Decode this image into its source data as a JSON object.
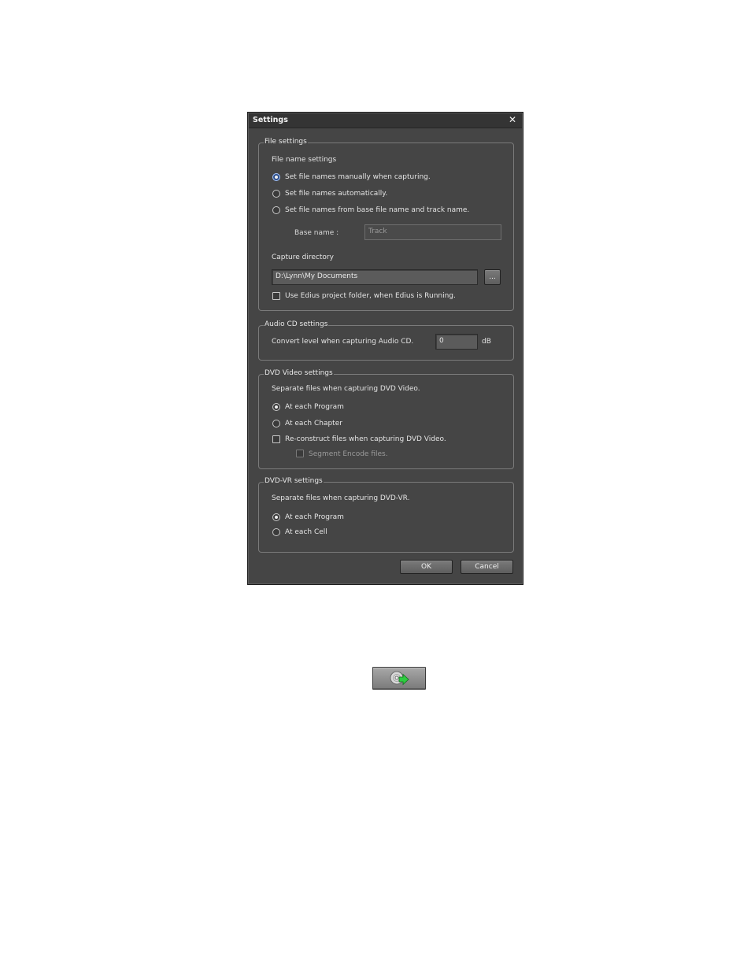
{
  "dialog": {
    "title": "Settings",
    "close_icon": "close-icon",
    "close_glyph": "✕"
  },
  "file_settings": {
    "legend": "File settings",
    "file_name_heading": "File name settings",
    "options": [
      {
        "label": "Set file names manually when capturing.",
        "selected": true
      },
      {
        "label": "Set file names automatically.",
        "selected": false
      },
      {
        "label": "Set file names from base file name and track name.",
        "selected": false
      }
    ],
    "base_name_label": "Base name :",
    "base_name_value": "Track",
    "capture_dir_heading": "Capture directory",
    "capture_dir_value": "D:\\Lynn\\My Documents",
    "browse_label": "...",
    "use_edius_label": "Use Edius project folder, when Edius is Running.",
    "use_edius_checked": false
  },
  "audio_cd": {
    "legend": "Audio CD settings",
    "convert_label": "Convert level when capturing Audio CD.",
    "level_value": "0",
    "unit": "dB"
  },
  "dvd_video": {
    "legend": "DVD Video settings",
    "separate_label": "Separate files when capturing DVD Video.",
    "options": [
      {
        "label": "At each Program",
        "selected": true
      },
      {
        "label": "At each Chapter",
        "selected": false
      }
    ],
    "reconstruct_label": "Re-construct files when capturing DVD Video.",
    "reconstruct_checked": false,
    "segment_label": "Segment Encode files.",
    "segment_checked": false
  },
  "dvd_vr": {
    "legend": "DVD-VR settings",
    "separate_label": "Separate files when capturing DVD-VR.",
    "options": [
      {
        "label": "At each Program",
        "selected": true
      },
      {
        "label": "At each Cell",
        "selected": false
      }
    ]
  },
  "footer": {
    "ok_label": "OK",
    "cancel_label": "Cancel"
  },
  "capture_button": {
    "icon": "disc-capture-icon",
    "colors": {
      "disc": "#d8d8d8",
      "arrow": "#2ecc40"
    }
  }
}
